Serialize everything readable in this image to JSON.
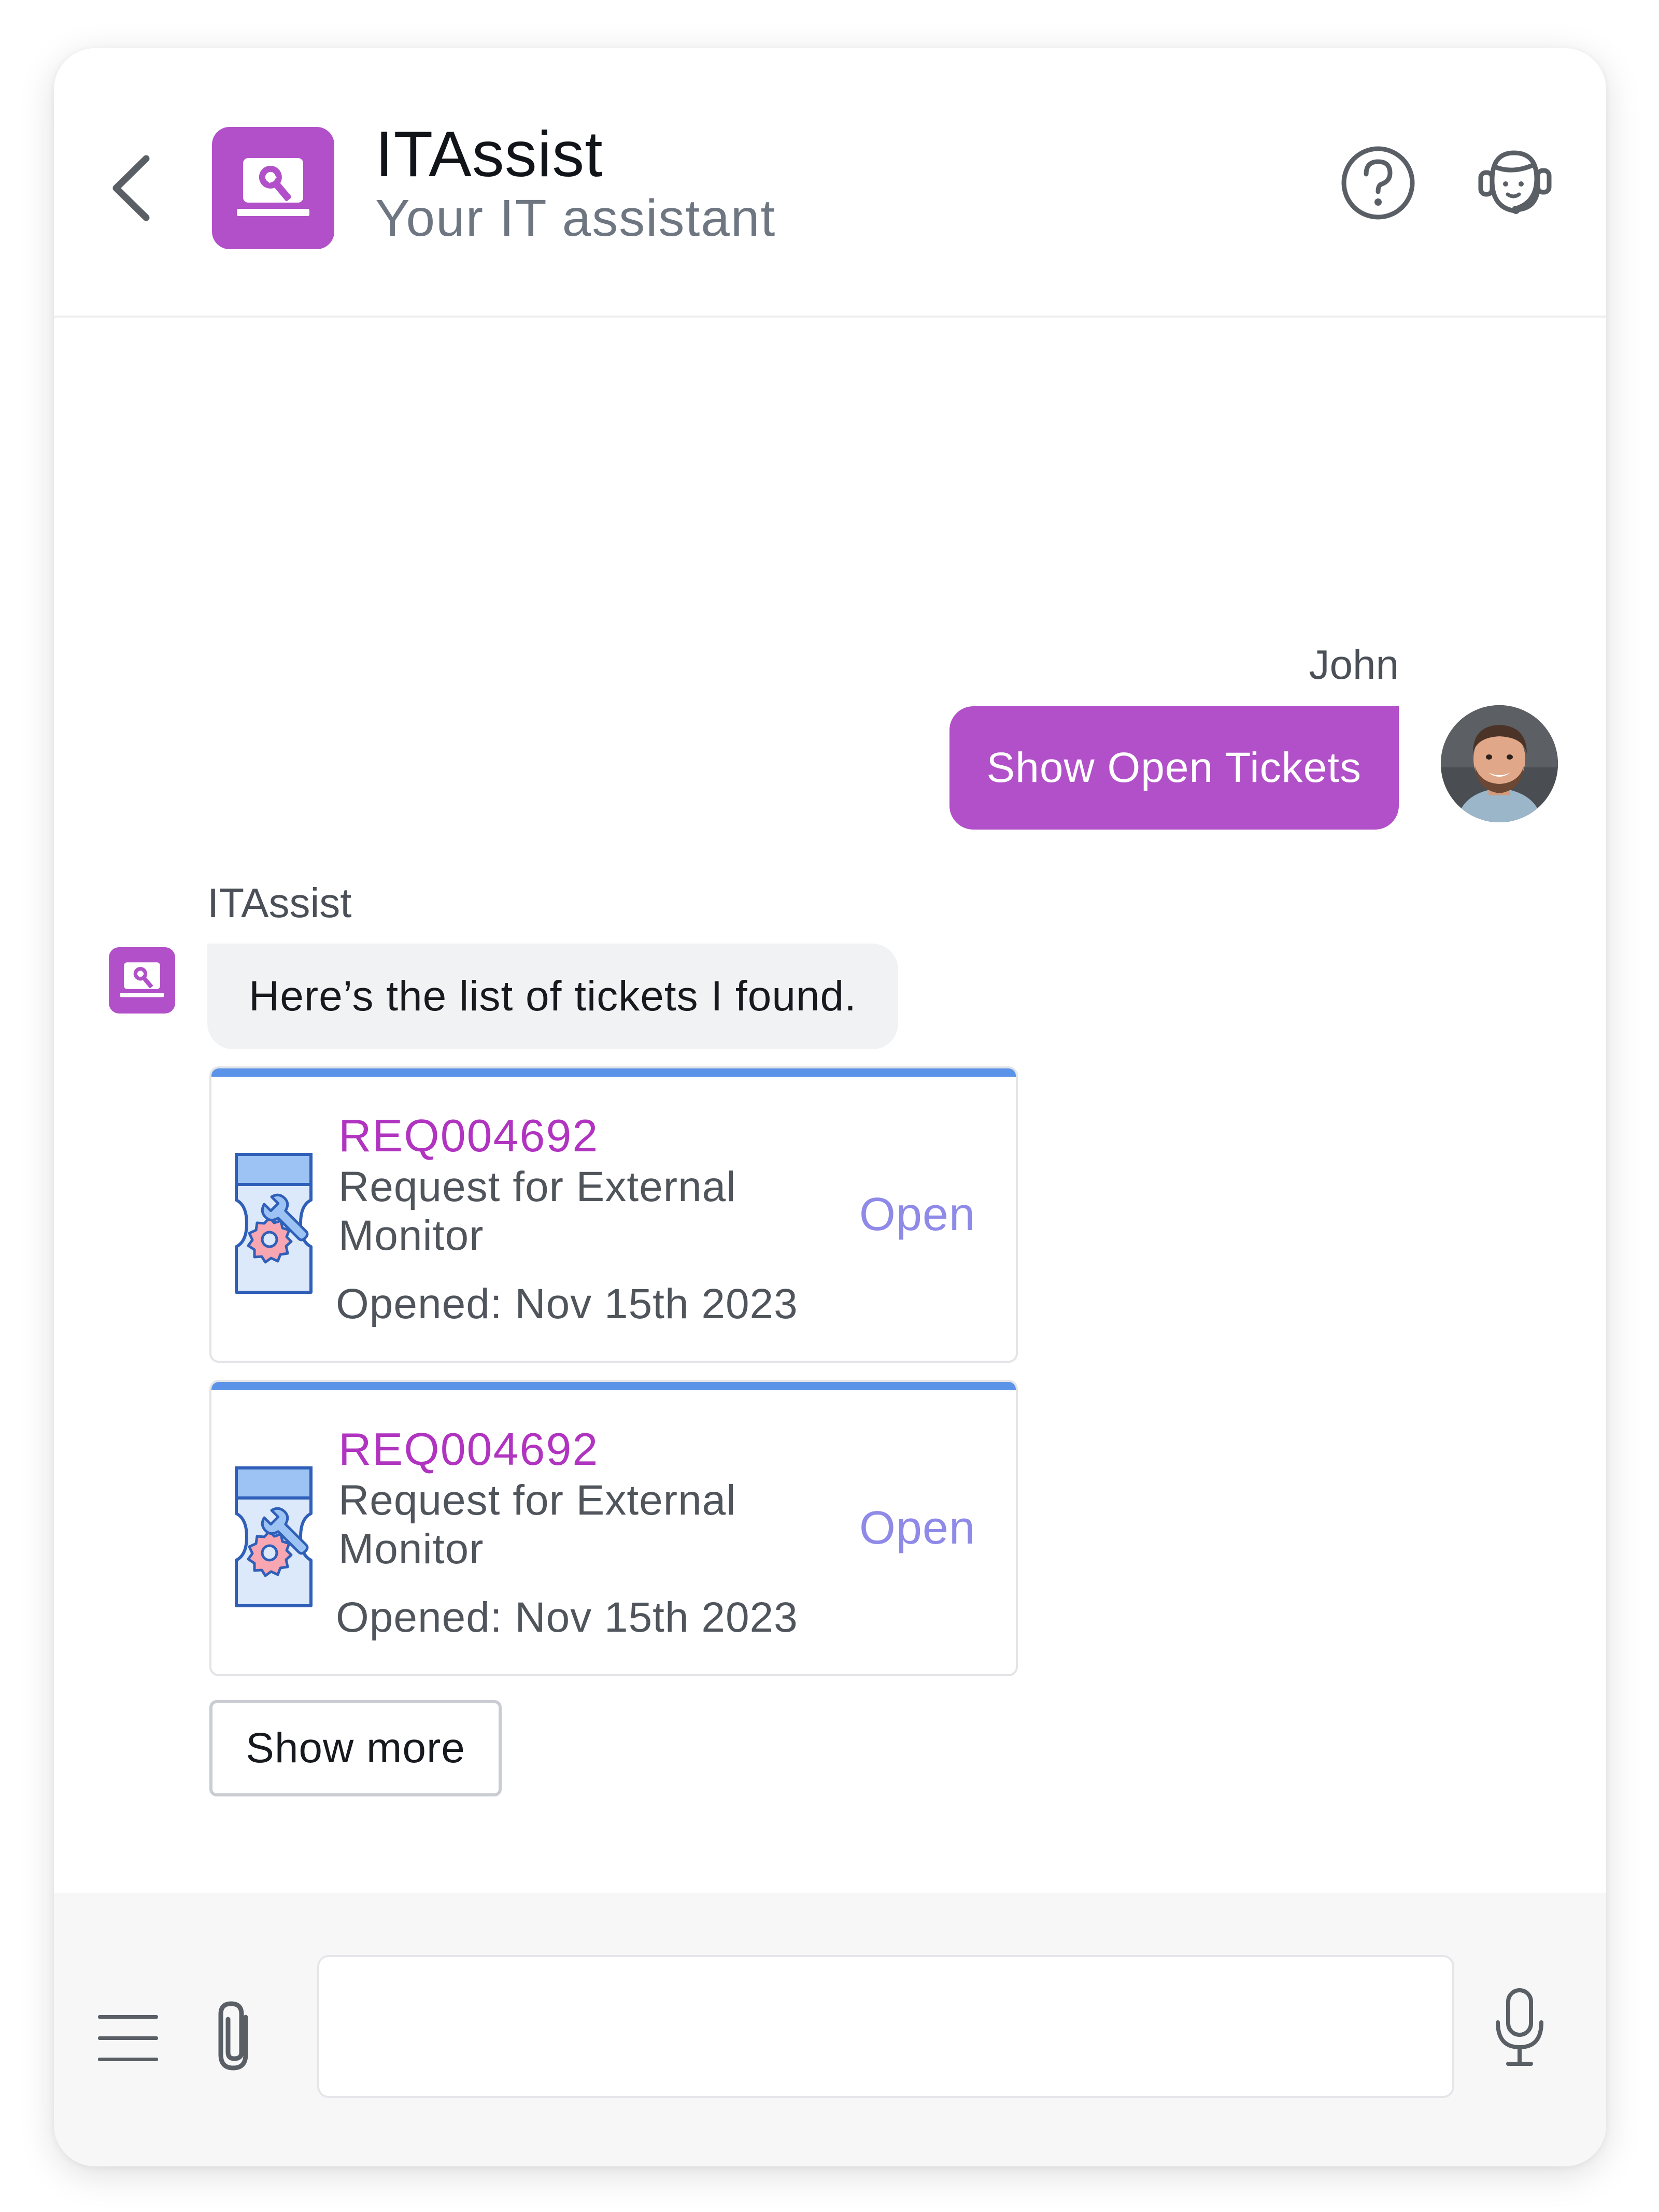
{
  "header": {
    "title": "ITAssist",
    "subtitle": "Your IT assistant"
  },
  "conversation": {
    "user_message": {
      "sender": "John",
      "text": "Show Open Tickets"
    },
    "bot_message": {
      "sender": "ITAssist",
      "text": "Here’s the list of tickets I found."
    },
    "tickets": [
      {
        "id": "REQ004692",
        "description": "Request for External Monitor",
        "opened": "Opened: Nov 15th 2023",
        "status": "Open"
      },
      {
        "id": "REQ004692",
        "description": "Request for External Monitor",
        "opened": "Opened: Nov 15th 2023",
        "status": "Open"
      }
    ],
    "show_more_label": "Show more"
  },
  "composer": {
    "placeholder": ""
  },
  "colors": {
    "brand": "#b150c8",
    "ticket_id": "#b034c0",
    "status_open": "#8f8ae8",
    "ticket_accent": "#5b93e8"
  },
  "icons": {
    "back": "chevron-left-icon",
    "logo": "laptop-wrench-icon",
    "help": "help-circle-icon",
    "agent": "agent-headset-icon",
    "ticket": "ticket-gear-icon",
    "menu": "hamburger-menu-icon",
    "attach": "paperclip-icon",
    "mic": "microphone-icon"
  }
}
